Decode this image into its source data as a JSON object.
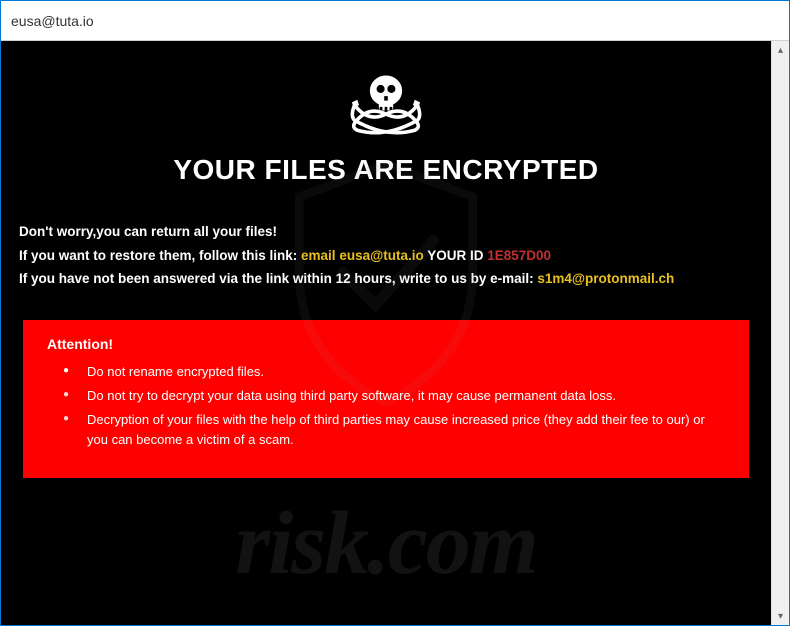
{
  "window": {
    "title": "eusa@tuta.io"
  },
  "heading": "YOUR FILES ARE ENCRYPTED",
  "intro": {
    "line1": "Don't worry,you can return all your files!",
    "line2_prefix": "If you want to restore them, follow this link: ",
    "line2_email_label": "email ",
    "line2_email": "eusa@tuta.io",
    "line2_id_label": "  YOUR ID ",
    "line2_id": "1E857D00",
    "line3_prefix": "If you have not been answered via the link within 12 hours, write to us by e-mail: ",
    "line3_email": "s1m4@protonmail.ch"
  },
  "attention": {
    "title": "Attention!",
    "items": [
      "Do not rename encrypted files.",
      "Do not try to decrypt your data using third party software, it may cause permanent data loss.",
      "Decryption of your files with the help of third parties may cause increased price (they add their fee to our) or you can become a victim of a scam."
    ]
  },
  "watermark": "risk.com",
  "scroll": {
    "up": "▴",
    "down": "▾"
  }
}
